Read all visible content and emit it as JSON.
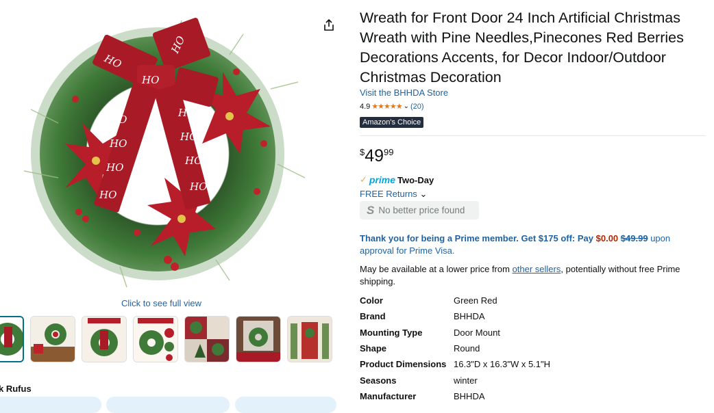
{
  "product": {
    "title": "Wreath for Front Door 24 Inch Artificial Christmas Wreath with Pine Needles,Pinecones Red Berries Decorations Accents, for Decor Indoor/Outdoor Christmas Decoration",
    "store_link": "Visit the BHHDA Store",
    "rating": "4.9",
    "stars_icon": "★★★★★",
    "review_count": "(20)",
    "badge": "Amazon's Choice"
  },
  "price": {
    "symbol": "$",
    "whole": "49",
    "fraction": "99"
  },
  "delivery": {
    "prime_word": "prime",
    "prime_speed": "Two-Day",
    "returns": "FREE Returns",
    "no_better_icon": "S",
    "no_better": "No better price found"
  },
  "prime_offer": {
    "intro": "Thank you for being a Prime member. Get $175 off: Pay",
    "pay": "$0.00",
    "was": "$49.99",
    "tail": "upon approval for Prime Visa."
  },
  "other_sellers": {
    "prefix": "May be available at a lower price from",
    "link": "other sellers",
    "suffix": ", potentially without free Prime shipping."
  },
  "specs": [
    {
      "label": "Color",
      "value": "Green Red"
    },
    {
      "label": "Brand",
      "value": "BHHDA"
    },
    {
      "label": "Mounting Type",
      "value": "Door Mount"
    },
    {
      "label": "Shape",
      "value": "Round"
    },
    {
      "label": "Product Dimensions",
      "value": "16.3\"D x 16.3\"W x 5.1\"H"
    },
    {
      "label": "Seasons",
      "value": "winter"
    },
    {
      "label": "Manufacturer",
      "value": "BHHDA"
    }
  ],
  "gallery": {
    "see_full": "Click to see full view",
    "thumb_count": 7
  },
  "rufus": {
    "label": "k Rufus"
  },
  "colors": {
    "link": "#2162a1",
    "price_red": "#b12704",
    "badge_bg": "#232f3e",
    "star": "#de7921",
    "prime_blue": "#00a8e1"
  }
}
